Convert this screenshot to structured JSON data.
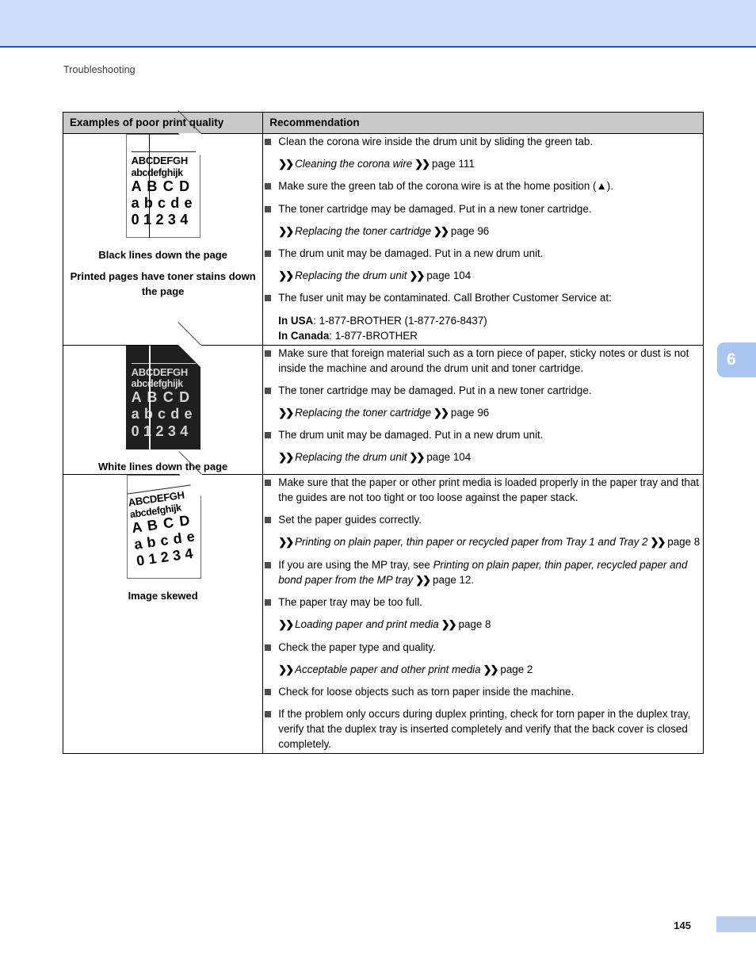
{
  "document": {
    "running_head": "Troubleshooting",
    "chapter_tab": "6",
    "page_number": "145"
  },
  "table": {
    "headers": {
      "col1": "Examples of poor print quality",
      "col2": "Recommendation"
    },
    "rows": [
      {
        "sample": {
          "type": "page-with-black-vertical-line",
          "lines": {
            "l1": "ABCDEFGH",
            "l2": "abcdefghijk",
            "l3": "A B C D",
            "l4": "a b c d e",
            "l5": "0 1 2 3 4"
          }
        },
        "captions": [
          "Black lines down the page",
          "Printed pages have toner stains down the page"
        ],
        "recommendations": [
          {
            "kind": "bullet",
            "text": "Clean the corona wire inside the drum unit by sliding the green tab."
          },
          {
            "kind": "xref",
            "title": "Cleaning the corona wire",
            "page": "page 111"
          },
          {
            "kind": "bullet",
            "text": "Make sure the green tab of the corona wire is at the home position (▲)."
          },
          {
            "kind": "bullet",
            "text": "The toner cartridge may be damaged. Put in a new toner cartridge."
          },
          {
            "kind": "xref",
            "title": "Replacing the toner cartridge",
            "page": "page 96"
          },
          {
            "kind": "bullet",
            "text": "The drum unit may be damaged. Put in a new drum unit."
          },
          {
            "kind": "xref",
            "title": "Replacing the drum unit",
            "page": "page 104"
          },
          {
            "kind": "bullet",
            "text": "The fuser unit may be contaminated. Call Brother Customer Service at:"
          },
          {
            "kind": "contact",
            "usa_label": "In USA",
            "usa_value": ": 1-877-BROTHER (1-877-276-8437)",
            "canada_label": "In Canada",
            "canada_value": ": 1-877-BROTHER"
          }
        ]
      },
      {
        "sample": {
          "type": "inverted-page-with-white-vertical-line",
          "lines": {
            "l1": "ABCDEFGH",
            "l2": "abcdefghijk",
            "l3": "A B C D",
            "l4": "a b c d e",
            "l5": "0 1 2 3 4"
          }
        },
        "captions": [
          "White lines down the page"
        ],
        "recommendations": [
          {
            "kind": "bullet",
            "text": "Make sure that foreign material such as a torn piece of paper, sticky notes or dust is not inside the machine and around the drum unit and toner cartridge."
          },
          {
            "kind": "bullet",
            "text": "The toner cartridge may be damaged. Put in a new toner cartridge."
          },
          {
            "kind": "xref",
            "title": "Replacing the toner cartridge",
            "page": "page 96"
          },
          {
            "kind": "bullet",
            "text": "The drum unit may be damaged. Put in a new drum unit."
          },
          {
            "kind": "xref",
            "title": "Replacing the drum unit",
            "page": "page 104"
          }
        ]
      },
      {
        "sample": {
          "type": "page-with-skewed-text",
          "lines": {
            "l1": "ABCDEFGH",
            "l2": "abcdefghijk",
            "l3": "A B C D",
            "l4": "a b c d e",
            "l5": "0 1 2 3 4"
          }
        },
        "captions": [
          "Image skewed"
        ],
        "recommendations": [
          {
            "kind": "bullet",
            "text": "Make sure that the paper or other print media is loaded properly in the paper tray and that the guides are not too tight or too loose against the paper stack."
          },
          {
            "kind": "bullet",
            "text": "Set the paper guides correctly."
          },
          {
            "kind": "xref",
            "title": "Printing on plain paper, thin paper or recycled paper from Tray 1 and Tray 2",
            "page": "page 8"
          },
          {
            "kind": "bullet-mixed",
            "pre": "If you are using the MP tray, see ",
            "italic": "Printing on plain paper, thin paper, recycled paper and bond paper from the MP tray",
            "post": "page 12."
          },
          {
            "kind": "bullet",
            "text": "The paper tray may be too full."
          },
          {
            "kind": "xref",
            "title": "Loading paper and print media",
            "page": "page 8"
          },
          {
            "kind": "bullet",
            "text": "Check the paper type and quality."
          },
          {
            "kind": "xref",
            "title": "Acceptable paper and other print media",
            "page": "page 2"
          },
          {
            "kind": "bullet",
            "text": "Check for loose objects such as torn paper inside the machine."
          },
          {
            "kind": "bullet",
            "text": "If the problem only occurs during duplex printing, check for torn paper in the duplex tray, verify that the duplex tray is inserted completely and verify that the back cover is closed completely."
          }
        ]
      }
    ]
  },
  "colors": {
    "header_band": "#cfddf8",
    "header_band_border": "#1a56c4",
    "table_header_bg": "#c9c9c9",
    "chapter_tab": "#a9c6f3",
    "folio_bar": "#b9ceef",
    "bullet": "#4d4d4d"
  }
}
